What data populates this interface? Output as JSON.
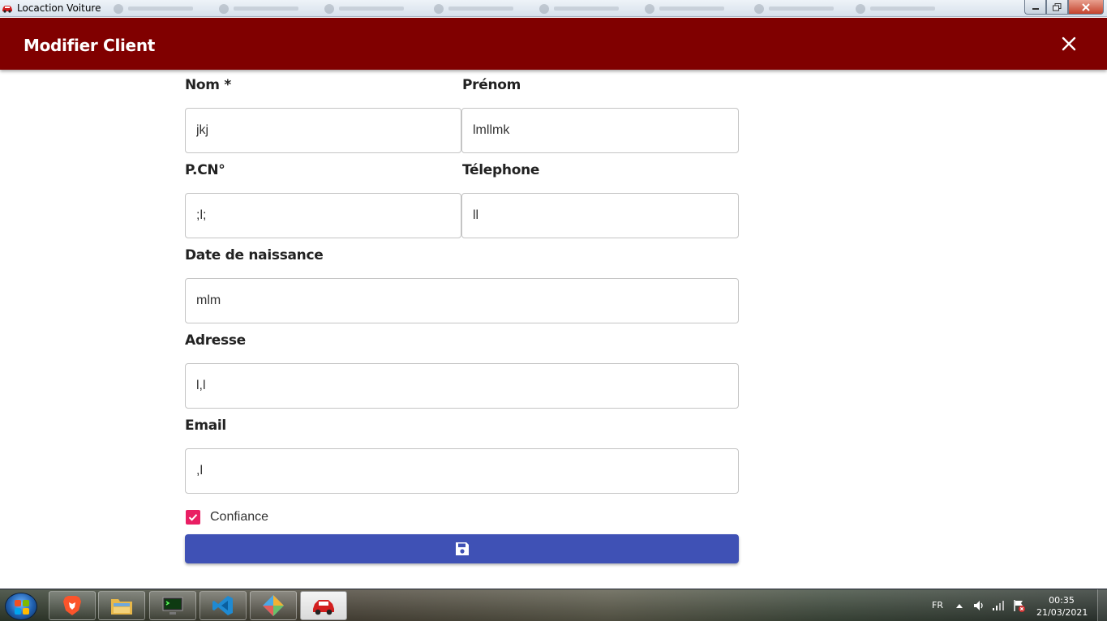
{
  "window": {
    "title": "Locaction Voiture",
    "controls": {
      "minimize_icon": "minimize-icon",
      "restore_icon": "restore-icon",
      "close_icon": "close-icon"
    }
  },
  "header": {
    "title": "Modifier Client",
    "close_icon": "close-x-icon",
    "background": "#800000"
  },
  "form": {
    "nom": {
      "label": "Nom *",
      "value": "jkj"
    },
    "prenom": {
      "label": "Prénom",
      "value": "lmllmk"
    },
    "pcn": {
      "label": "P.CN°",
      "value": ";l;"
    },
    "telephone": {
      "label": "Télephone",
      "value": "ll"
    },
    "date_naissance": {
      "label": "Date de naissance",
      "value": "mlm"
    },
    "adresse": {
      "label": "Adresse",
      "value": "l,l"
    },
    "email": {
      "label": "Email",
      "value": ",l"
    },
    "confiance": {
      "label": "Confiance",
      "checked": true,
      "color": "#e91e63"
    },
    "save_button": {
      "icon": "floppy-disk-icon",
      "color": "#3f51b5"
    }
  },
  "taskbar": {
    "pinned": [
      {
        "name": "brave-browser",
        "icon": "brave-lion-icon"
      },
      {
        "name": "file-explorer",
        "icon": "folder-icon"
      },
      {
        "name": "terminal",
        "icon": "monitor-terminal-icon"
      },
      {
        "name": "visual-studio-code",
        "icon": "vscode-icon"
      },
      {
        "name": "app-launcher",
        "icon": "diamond-app-icon"
      },
      {
        "name": "locaction-voiture",
        "icon": "red-car-icon",
        "active": true
      }
    ],
    "tray": {
      "language": "FR",
      "icons": [
        "show-hidden-icons-icon",
        "volume-icon",
        "network-icon",
        "action-center-flag-icon"
      ]
    },
    "clock": {
      "time": "00:35",
      "date": "21/03/2021"
    }
  }
}
